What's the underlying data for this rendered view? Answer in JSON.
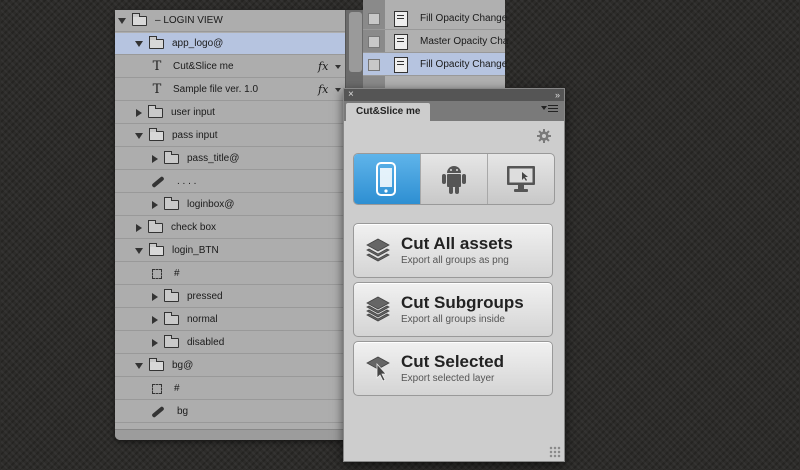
{
  "layers_panel": {
    "rows": [
      {
        "label": "– LOGIN VIEW"
      },
      {
        "label": "app_logo@"
      },
      {
        "label": "Cut&Slice me",
        "fx": "fx"
      },
      {
        "label": "Sample file ver. 1.0",
        "fx": "fx"
      },
      {
        "label": "user input"
      },
      {
        "label": "pass input"
      },
      {
        "label": "pass_title@"
      },
      {
        "label": ". . . ."
      },
      {
        "label": "loginbox@"
      },
      {
        "label": "check box"
      },
      {
        "label": "login_BTN"
      },
      {
        "label": "#"
      },
      {
        "label": "pressed"
      },
      {
        "label": "normal"
      },
      {
        "label": "disabled"
      },
      {
        "label": "bg@"
      },
      {
        "label": "#"
      },
      {
        "label": "bg"
      }
    ]
  },
  "actions_panel": {
    "items": [
      {
        "label": "Fill Opacity Change"
      },
      {
        "label": "Master Opacity Cha"
      },
      {
        "label": "Fill Opacity Change"
      }
    ]
  },
  "plugin_panel": {
    "close_glyph": "×",
    "collapse_glyph": "»",
    "tab_label": "Cut&Slice me",
    "platforms": [
      {
        "icon": "iphone-icon",
        "selected": true
      },
      {
        "icon": "android-icon",
        "selected": false
      },
      {
        "icon": "desktop-icon",
        "selected": false
      }
    ],
    "buttons": [
      {
        "title": "Cut All assets",
        "subtitle": "Export all groups as png",
        "icon": "layers-stack-icon"
      },
      {
        "title": "Cut Subgroups",
        "subtitle": "Export all groups inside",
        "icon": "sublayers-icon"
      },
      {
        "title": "Cut Selected",
        "subtitle": "Export selected layer",
        "icon": "cursor-layer-icon"
      }
    ],
    "colors": {
      "selected_platform": "#3a9ee0",
      "selected_row": "#b6c4e0"
    }
  }
}
